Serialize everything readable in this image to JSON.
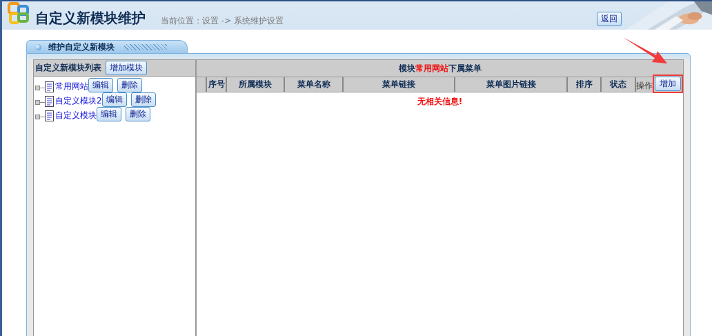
{
  "header": {
    "title": "自定义新模块维护",
    "breadcrumb": "当前位置：设置 -> 系统维护设置",
    "back_button": "返回"
  },
  "panel": {
    "tab": "维护自定义新模块"
  },
  "module_list": {
    "title": "自定义新模块列表",
    "add_button": "增加模块",
    "items": [
      {
        "name": "常用网站",
        "edit": "编辑",
        "delete": "删除"
      },
      {
        "name": "自定义模块2",
        "edit": "编辑",
        "delete": "删除"
      },
      {
        "name": "自定义模块",
        "edit": "编辑",
        "delete": "删除"
      }
    ]
  },
  "menu_table": {
    "title_prefix": "模块",
    "title_module": "常用网站",
    "title_suffix": "下属菜单",
    "columns": [
      "序号",
      "所属模块",
      "菜单名称",
      "菜单链接",
      "菜单图片链接",
      "排序",
      "状态",
      "操作"
    ],
    "add_button": "增加",
    "add_highlighted": true,
    "empty_message": "无相关信息!"
  }
}
